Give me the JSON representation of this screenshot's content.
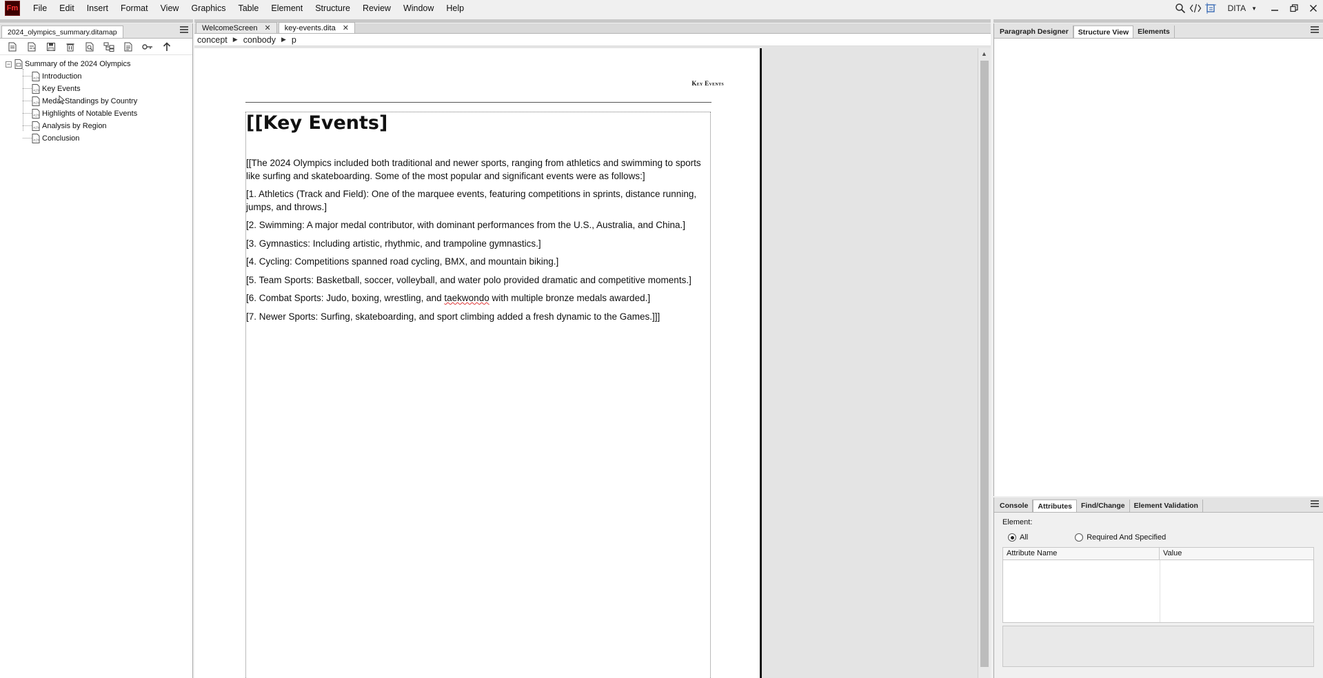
{
  "app": {
    "logo_text": "Fm",
    "menu": [
      "File",
      "Edit",
      "Insert",
      "Format",
      "View",
      "Graphics",
      "Table",
      "Element",
      "Structure",
      "Review",
      "Window",
      "Help"
    ],
    "workspace": "DITA",
    "toolbar_icons": [
      "search-icon",
      "code-view-icon",
      "frame-view-icon"
    ]
  },
  "left_panel": {
    "tab_label": "2024_olympics_summary.ditamap",
    "toolbar_icons": [
      "new-topic-icon",
      "insert-topic-icon",
      "save-icon",
      "delete-icon",
      "preview-icon",
      "hierarchy-icon",
      "properties-icon",
      "key-icon",
      "move-up-icon"
    ],
    "tree": {
      "root": "Summary of the 2024 Olympics",
      "children": [
        "Introduction",
        "Key Events",
        "Medal Standings by Country",
        "Highlights of Notable Events",
        "Analysis by Region",
        "Conclusion"
      ]
    }
  },
  "document": {
    "tabs": [
      {
        "label": "WelcomeScreen",
        "active": false
      },
      {
        "label": "key-events.dita",
        "active": true
      }
    ],
    "breadcrumb": [
      "concept",
      "conbody",
      "p"
    ],
    "running_header": "Key Events",
    "title": "[[Key Events]",
    "paragraphs": {
      "intro": "[[The 2024 Olympics included both traditional and newer sports, ranging from athletics and swimming to sports like surfing and skateboarding. Some of the most popular and significant events were as follows:]",
      "p1": "[1. Athletics (Track and Field): One of the marquee events, featuring competitions in sprints, distance running, jumps, and throws.]",
      "p2": "[2. Swimming: A major medal contributor, with dominant performances from the U.S., Australia, and China.]",
      "p3": "[3. Gymnastics: Including artistic, rhythmic, and trampoline gymnastics.]",
      "p4": "[4. Cycling: Competitions spanned road cycling, BMX, and mountain biking.]",
      "p5": "[5. Team Sports: Basketball, soccer, volleyball, and water polo provided dramatic and competitive moments.]",
      "p6_before": "[6. Combat Sports: Judo, boxing, wrestling, and ",
      "p6_flagged": "taekwondo",
      "p6_after": " with multiple bronze medals awarded.]",
      "p7": "[7. Newer Sports: Surfing, skateboarding, and sport climbing added a fresh dynamic to the Games.]]]"
    }
  },
  "right_top": {
    "tabs": [
      {
        "label": "Paragraph Designer",
        "active": false
      },
      {
        "label": "Structure View",
        "active": true
      },
      {
        "label": "Elements",
        "active": false
      }
    ]
  },
  "right_bottom": {
    "tabs": [
      {
        "label": "Console",
        "active": false
      },
      {
        "label": "Attributes",
        "active": true
      },
      {
        "label": "Find/Change",
        "active": false
      },
      {
        "label": "Element Validation",
        "active": false
      }
    ],
    "element_label": "Element:",
    "radio_all": "All",
    "radio_required": "Required And Specified",
    "selected_radio": "All",
    "col_name": "Attribute Name",
    "col_value": "Value"
  }
}
